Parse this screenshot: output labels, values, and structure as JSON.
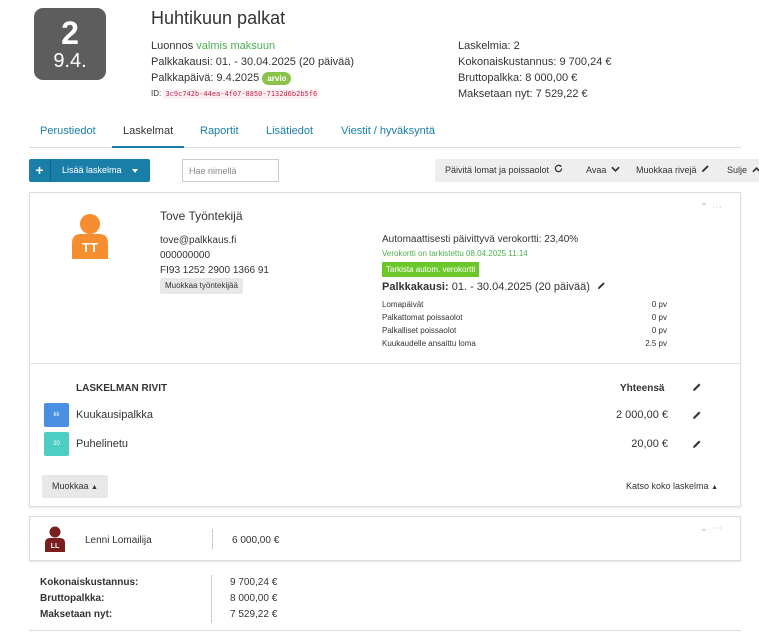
{
  "header": {
    "day_number": "2",
    "date_short": "9.4.",
    "title": "Huhtikuun palkat",
    "status_prefix": "Luonnos",
    "status_highlight": "valmis maksuun",
    "period_line": "Palkkakausi: 01. - 30.04.2025 (20 päivää)",
    "payday_line": "Palkkapäivä: 9.4.2025",
    "payday_badge": "arvio",
    "id_label": "ID:",
    "id_value": "3c9c742b-44ea-4f07-8850-7132d6b2b5f6",
    "count_line": "Laskelmia: 2",
    "total_cost_line": "Kokonaiskustannus: 9 700,24 €",
    "gross_line": "Bruttopalkka: 8 000,00 €",
    "pay_now_line": "Maksetaan nyt: 7 529,22 €"
  },
  "tabs": [
    {
      "label": "Perustiedot",
      "active": false
    },
    {
      "label": "Laskelmat",
      "active": true
    },
    {
      "label": "Raportit",
      "active": false
    },
    {
      "label": "Lisätiedot",
      "active": false
    },
    {
      "label": "Viestit / hyväksyntä",
      "active": false
    }
  ],
  "toolbar": {
    "add_icon": "plus-icon",
    "add_label": "Lisää laskelma",
    "search_placeholder": "Hae nimellä",
    "refresh_label": "Päivitä lomat ja poissaolot",
    "open_label": "Avaa",
    "edit_rows_label": "Muokkaa rivejä",
    "close_label": "Sulje"
  },
  "employee1": {
    "name": "Tove Työntekijä",
    "initials": "TT",
    "avatar_color": "#f68d2e",
    "email": "tove@palkkaus.fi",
    "phone": "000000000",
    "iban": "FI93 1252 2900 1366 91",
    "edit_button": "Muokkaa työntekijää",
    "tax_card": "Automaattisesti päivittyvä verokortti: 23,40%",
    "tax_checked": "Verokortti on tarkistettu 08.04.2025 11:14",
    "check_button": "Tarkista autom. verokortti",
    "period_label": "Palkkakausi:",
    "period_value": "01. - 30.04.2025 (20 päivää)",
    "leave_rows": [
      {
        "label": "Lomapäivät",
        "value": "0 pv"
      },
      {
        "label": "Palkattomat poissaolot",
        "value": "0 pv"
      },
      {
        "label": "Palkalliset poissaolot",
        "value": "0 pv"
      },
      {
        "label": "Kuukaudelle ansaittu loma",
        "value": "2.5 pv"
      }
    ],
    "rows_title": "LASKELMAN RIVIT",
    "total_title": "Yhteensä",
    "pay_rows": [
      {
        "icon_text": "kk",
        "icon_color": "#4a90e2",
        "label": "Kuukausipalkka",
        "value": "2 000,00 €"
      },
      {
        "icon_text": "20",
        "icon_color": "#4ecdc4",
        "label": "Puhelinetu",
        "value": "20,00 €"
      }
    ],
    "edit_label": "Muokkaa",
    "see_all_label": "Katso koko laskelma"
  },
  "employee2": {
    "name": "Lenni Lomailija",
    "initials": "LL",
    "avatar_color": "#7a1f1f",
    "amount": "6 000,00 €"
  },
  "summary": [
    {
      "label": "Kokonaiskustannus:",
      "value": "9 700,24 €"
    },
    {
      "label": "Bruttopalkka:",
      "value": "8 000,00 €"
    },
    {
      "label": "Maksetaan nyt:",
      "value": "7 529,22 €"
    }
  ],
  "colors": {
    "primary": "#1a7fa8",
    "success": "#4caf50"
  }
}
